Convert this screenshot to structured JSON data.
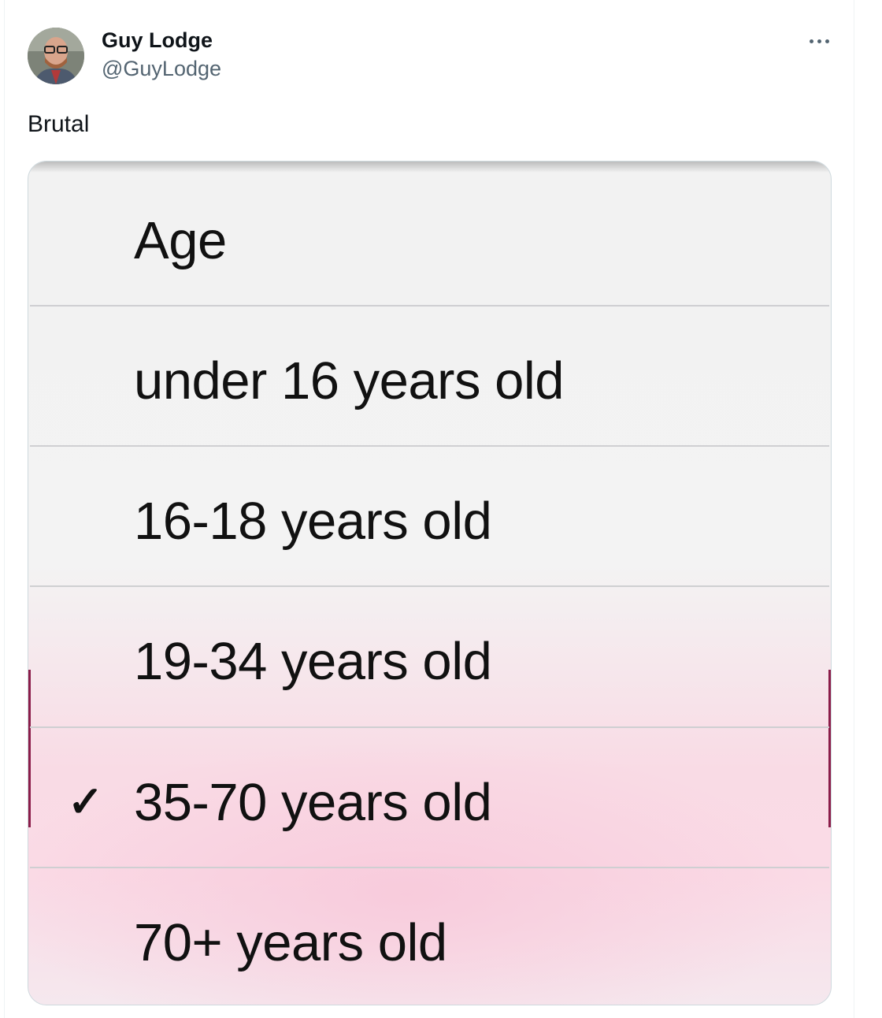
{
  "tweet": {
    "author_name": "Guy Lodge",
    "author_handle": "@GuyLodge",
    "text": "Brutal",
    "more_icon": "more-horizontal-icon"
  },
  "age_menu": {
    "title": "Age",
    "options": [
      {
        "label": "under 16 years old",
        "selected": false
      },
      {
        "label": "16-18 years old",
        "selected": false
      },
      {
        "label": "19-34 years old",
        "selected": false
      },
      {
        "label": "35-70 years old",
        "selected": true
      },
      {
        "label": "70+ years old",
        "selected": false
      }
    ],
    "check_glyph": "✓"
  },
  "colors": {
    "text_primary": "#0f1419",
    "text_secondary": "#536471",
    "highlight_pink": "#f9dbe5",
    "menu_background": "#f2f2f2"
  }
}
